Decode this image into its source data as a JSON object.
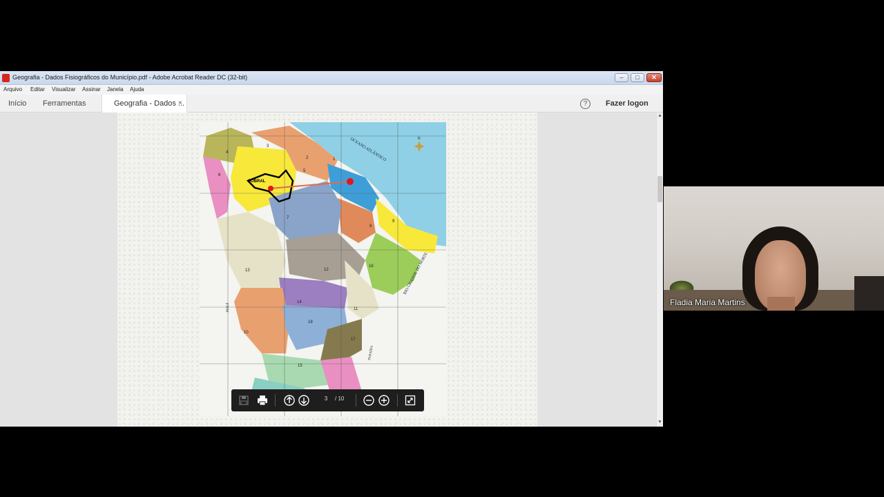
{
  "window": {
    "title": "Geografia - Dados Fisiográficos do Município.pdf - Adobe Acrobat Reader DC (32-bit)",
    "buttons": {
      "minimize": "–",
      "maximize": "□",
      "close": "✕"
    }
  },
  "menu": [
    "Arquivo",
    "Editar",
    "Visualizar",
    "Assinar",
    "Janela",
    "Ajuda"
  ],
  "tabs": {
    "home": "Início",
    "tools": "Ferramentas",
    "document": "Geografia - Dados ...",
    "close": "×"
  },
  "header": {
    "help": "?",
    "login": "Fazer logon"
  },
  "map": {
    "ocean_label": "OCEANO ATLÂNTICO",
    "city_label": "SOBRAL",
    "state_east": "RIO GRANDE DO NORTE",
    "state_south": "PARAÍBA",
    "state_west": "PIAUÍ",
    "compass": "N",
    "region_numbers": [
      "1",
      "2",
      "3",
      "4",
      "5",
      "6",
      "7",
      "8",
      "9",
      "10",
      "11",
      "12",
      "13",
      "14",
      "15",
      "16",
      "17",
      "18"
    ],
    "colors": {
      "ocean": "#8fd0e6",
      "yellow": "#f7e83a",
      "pink": "#e98fc1",
      "olive": "#b9b55a",
      "blue": "#3e9fd8",
      "orange": "#e08a5c",
      "green": "#9ccd5a",
      "gray": "#a79f93",
      "purple": "#9b7fc1",
      "peach": "#e9a06f",
      "light": "#e6e2c7",
      "marker": "#e8141b"
    }
  },
  "toolbar": {
    "current_page": "3",
    "total_pages": "/ 10",
    "icons": [
      "save-icon",
      "print-icon",
      "page-up-icon",
      "page-down-icon",
      "zoom-out-icon",
      "zoom-in-icon",
      "fit-page-icon"
    ]
  },
  "video": {
    "participant_name": "Fladia Maria Martins"
  }
}
